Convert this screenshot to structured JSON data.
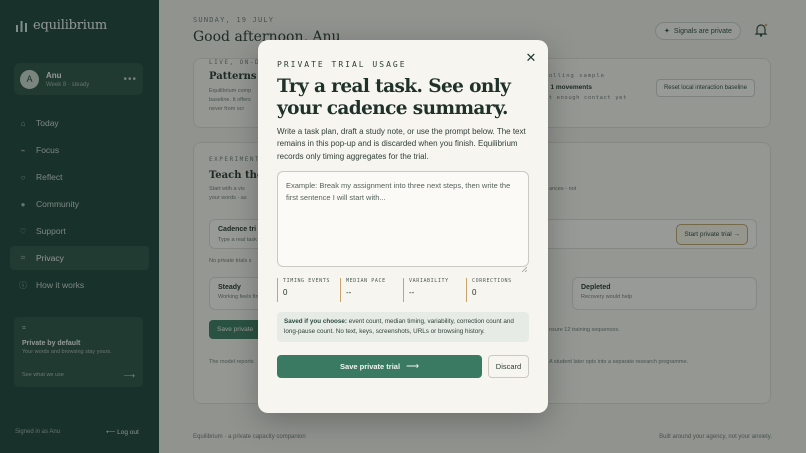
{
  "app": {
    "brand": "equilibrium"
  },
  "sidebar": {
    "user": {
      "initial": "A",
      "name": "Anu",
      "subtitle": "Week 8 · steady"
    },
    "nav": [
      {
        "label": "Today",
        "icon": "home-icon",
        "glyph": "⌂"
      },
      {
        "label": "Focus",
        "icon": "focus-icon",
        "glyph": "⌁"
      },
      {
        "label": "Reflect",
        "icon": "reflect-icon",
        "glyph": "○"
      },
      {
        "label": "Community",
        "icon": "community-icon",
        "glyph": "●"
      },
      {
        "label": "Support",
        "icon": "heart-icon",
        "glyph": "♡"
      },
      {
        "label": "Privacy",
        "icon": "privacy-icon",
        "glyph": "⌗"
      },
      {
        "label": "How it works",
        "icon": "info-icon",
        "glyph": "ⓘ"
      }
    ],
    "privacy_card": {
      "title": "Private by default",
      "subtitle": "Your words and browsing stay yours.",
      "link": "See what we use"
    },
    "signed_in": "Signed in as Anu",
    "logout": "Log out"
  },
  "header": {
    "date": "SUNDAY, 19 JULY",
    "greeting": "Good afternoon, Anu",
    "signals": "Signals are private"
  },
  "bg_panel1": {
    "eyebrow": "LIVE, ON-DE",
    "title": "Patterns ne",
    "text_line1": "Equilibrium comp",
    "text_line2": "baseline. It offers",
    "text_line3": "never from scr",
    "sample_label": "Scrolling sample",
    "sample_moves": "1 movements",
    "sample_sub": "Not enough contact yet",
    "reset": "Reset local interaction baseline"
  },
  "bg_panel2": {
    "eyebrow": "EXPERIMENT",
    "title": "Teach the r",
    "text_line1": "Start with a vis",
    "text_line2": "your words - as",
    "right_text": "ances - not",
    "trial_title": "Cadence tri",
    "trial_sub": "Type a real task",
    "start_trial": "Start private trial →",
    "no_trials": "No private trials s",
    "state_steady_title": "Steady",
    "state_steady_sub": "Working feels fin",
    "state_depleted_title": "Depleted",
    "state_depleted_sub": "Recovery would help",
    "save_private": "Save private",
    "sequences": "nsure 12 training sequences.",
    "model_note": "The model reports",
    "programme_note": "A student later opts into a separate research programme."
  },
  "footer": {
    "left": "Equilibrium · a private capacity companion",
    "right": "Built around your agency, not your anxiety."
  },
  "modal": {
    "eyebrow": "PRIVATE TRIAL USAGE",
    "title": "Try a real task. See only your cadence summary.",
    "description": "Write a task plan, draft a study note, or use the prompt below. The text remains in this pop-up and is discarded when you finish. Equilibrium records only timing aggregates for the trial.",
    "textarea_placeholder": "Example: Break my assignment into three next steps, then write the first sentence I will start with...",
    "stats": [
      {
        "label": "TIMING EVENTS",
        "value": "0"
      },
      {
        "label": "MEDIAN PACE",
        "value": "--"
      },
      {
        "label": "VARIABILITY",
        "value": "--"
      },
      {
        "label": "CORRECTIONS",
        "value": "0"
      }
    ],
    "saved_lead": "Saved if you choose:",
    "saved_text": " event count, median timing, variability, correction count and long-pause count. No text, keys, screenshots, URLs or browsing history.",
    "save_button": "Save private trial",
    "save_arrow": "⟶",
    "discard_button": "Discard",
    "close": "✕"
  },
  "colors": {
    "sidebar": "#1d4338",
    "accent": "#3b7a62",
    "gold": "#c9a36b",
    "modal_bg": "#f7f5ef"
  }
}
